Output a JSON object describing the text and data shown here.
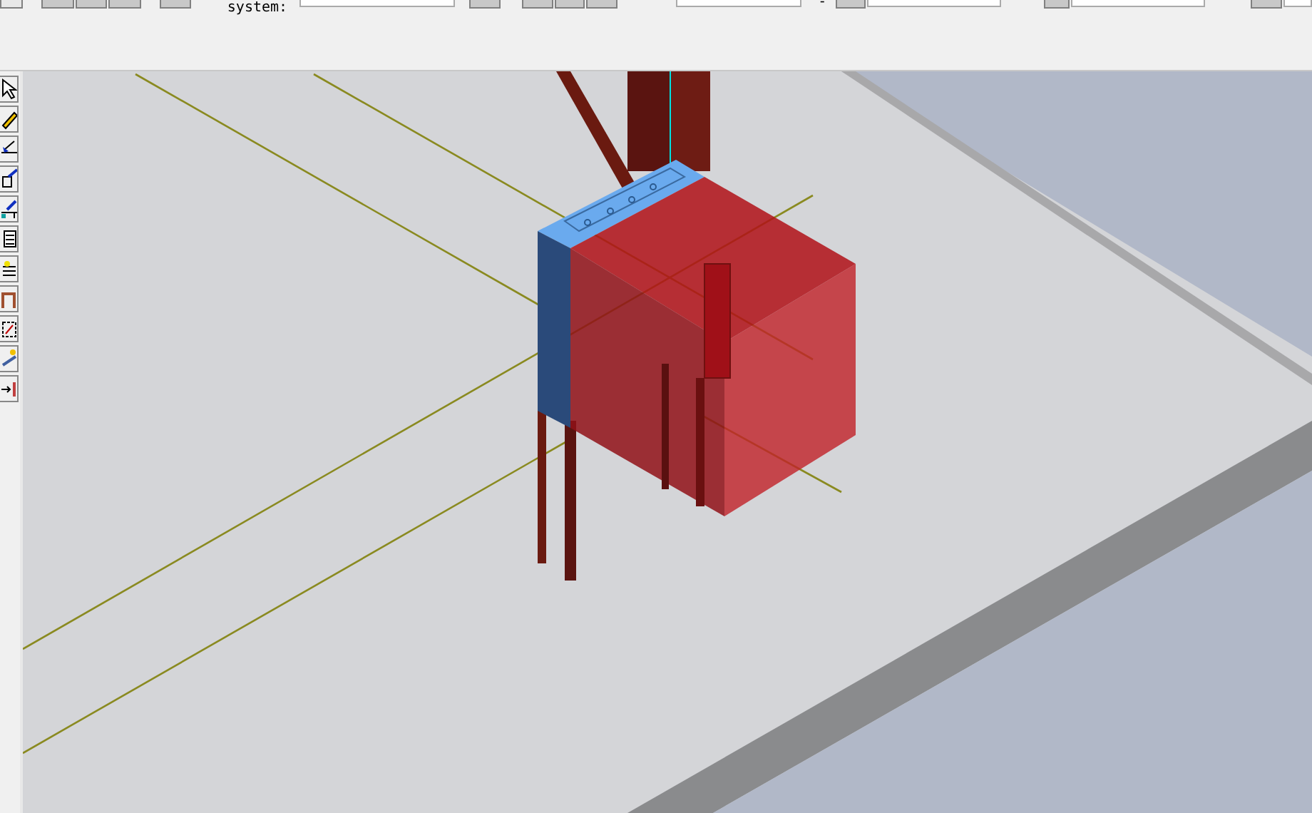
{
  "toolbar": {
    "label": "system:",
    "separator_text": "-"
  }
}
